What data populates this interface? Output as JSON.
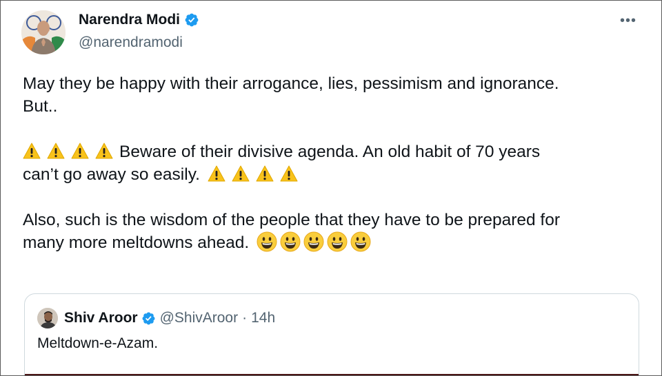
{
  "author": {
    "name": "Narendra Modi",
    "handle": "@narendramodi",
    "verified": true,
    "avatar_icon": "profile-photo"
  },
  "menu": {
    "more_label": "•••"
  },
  "tweet": {
    "line1": "May they be happy with their arrogance, lies, pessimism and ignorance.",
    "line2": "But..",
    "para2_text": "Beware of their divisive agenda. An old habit of 70 years",
    "para2_line2": "can’t go away so easily.",
    "para3_line1": "Also, such is the wisdom of the people that they have to be prepared for",
    "para3_line2": "many more meltdowns ahead."
  },
  "quote": {
    "name": "Shiv Aroor",
    "handle": "@ShivAroor",
    "separator": "·",
    "time": "14h",
    "text": "Meltdown-e-Azam."
  },
  "colors": {
    "verified_blue": "#1d9bf0",
    "secondary_text": "#536471",
    "warning_yellow": "#f8c21b",
    "smile_yellow": "#f9cd3c"
  }
}
